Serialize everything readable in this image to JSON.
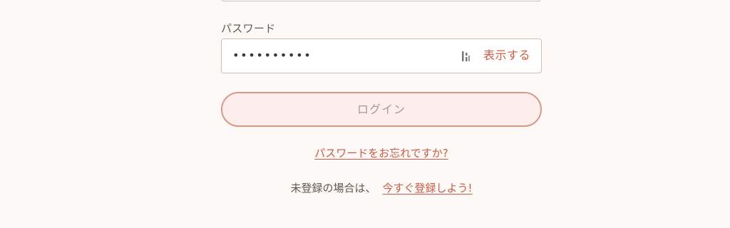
{
  "password": {
    "label": "パスワード",
    "value_masked": "••••••••••",
    "show_label": "表示する",
    "manager_icon": "password-manager-icon"
  },
  "login": {
    "button_label": "ログイン"
  },
  "links": {
    "forgot_password": "パスワードをお忘れですか?",
    "register_prompt": "未登録の場合は、",
    "register_link": "今すぐ登録しよう!"
  },
  "colors": {
    "accent": "#c85c48",
    "button_border": "#d9978a",
    "button_fill": "#fbeeed",
    "background": "#fbf8f5"
  }
}
